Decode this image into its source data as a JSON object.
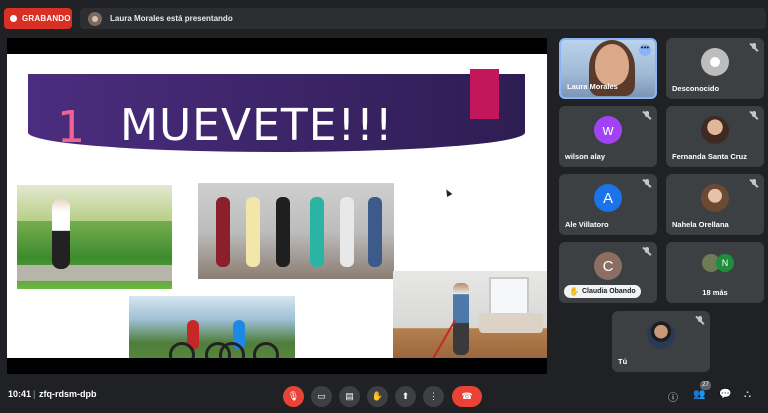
{
  "recording": {
    "label": "GRABANDO",
    "color": "#d93025"
  },
  "presenting": {
    "text": "Laura Morales está presentando"
  },
  "slide": {
    "number": "1",
    "title": "MUEVETE!!!"
  },
  "participants": [
    {
      "name": "Laura Morales",
      "type": "video"
    },
    {
      "name": "Desconocido",
      "type": "generic-avatar",
      "mic": "muted"
    },
    {
      "name": "wilson alay",
      "initial": "w",
      "color": "#a142f4",
      "mic": "muted"
    },
    {
      "name": "Fernanda Santa Cruz",
      "type": "photo",
      "mic": "muted"
    },
    {
      "name": "Ale Villatoro",
      "initial": "A",
      "color": "#1a73e8",
      "mic": "muted"
    },
    {
      "name": "Nahela Orellana",
      "type": "photo",
      "mic": "muted"
    },
    {
      "name": "Claudia Obando",
      "initial": "C",
      "color": "#8d6e63",
      "mic": "muted",
      "hand_raised": true
    },
    {
      "name": "18 más",
      "initial": "N",
      "type": "more"
    },
    {
      "name": "Tú",
      "type": "photo",
      "mic": "muted"
    }
  ],
  "bottom": {
    "time": "10:41",
    "separator": "|",
    "meeting_code": "zfq-rdsm-dpb",
    "participant_count": "27",
    "controls": [
      "mic-off",
      "camera",
      "captions",
      "raise-hand",
      "present",
      "more",
      "leave-call"
    ]
  }
}
